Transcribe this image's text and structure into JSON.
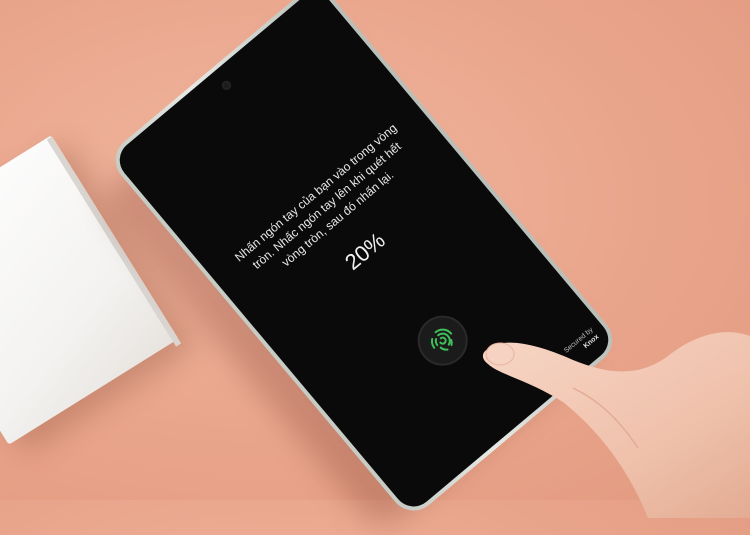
{
  "scene": {
    "background_color": "#eba88f",
    "box_color": "#f5f4f2",
    "phone_frame_color": "#d6dad4"
  },
  "screen": {
    "instruction_text": "Nhấn ngón tay của bạn vào trong vòng tròn. Nhấc ngón tay lên khi quét hết vòng tròn, sau đó nhấn lại.",
    "progress_text": "20%",
    "progress_fraction": 0.2,
    "fingerprint_icon": "fingerprint-icon",
    "fingerprint_color": "#3fbf5a",
    "secured_by_line1": "Secured by",
    "secured_by_line2": "Knox"
  }
}
